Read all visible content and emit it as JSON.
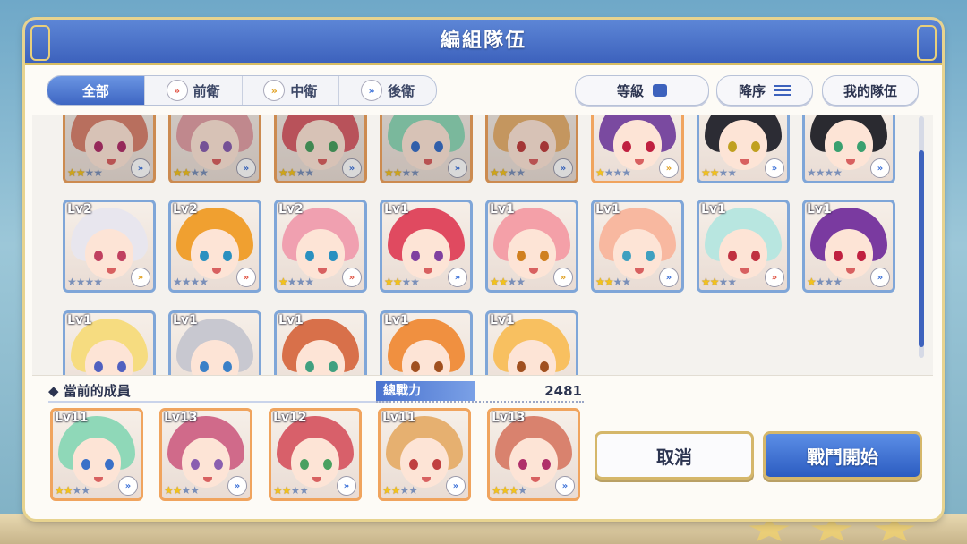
{
  "window": {
    "title": "編組隊伍"
  },
  "filters": {
    "tabs": [
      {
        "label": "全部",
        "icon": ""
      },
      {
        "label": "前衛",
        "icon": "front-position-icon"
      },
      {
        "label": "中衛",
        "icon": "middle-position-icon"
      },
      {
        "label": "後衛",
        "icon": "rear-position-icon"
      }
    ],
    "active": "全部"
  },
  "sort": {
    "level_label": "等級",
    "order_label": "降序",
    "my_team_label": "我的隊伍"
  },
  "roster": {
    "row1": [
      {
        "level": "",
        "stars": 2,
        "position": "back",
        "selected": true,
        "frame": "orange",
        "hair": "#d9826e",
        "eye": "#b0306a"
      },
      {
        "level": "",
        "stars": 2,
        "position": "back",
        "selected": true,
        "frame": "orange",
        "hair": "#e2a0a6",
        "eye": "#8a5fb0"
      },
      {
        "level": "",
        "stars": 2,
        "position": "back",
        "selected": true,
        "frame": "orange",
        "hair": "#d8606a",
        "eye": "#4aa060"
      },
      {
        "level": "",
        "stars": 2,
        "position": "back",
        "selected": true,
        "frame": "orange",
        "hair": "#8fd8b8",
        "eye": "#3a70c8"
      },
      {
        "level": "",
        "stars": 2,
        "position": "back",
        "selected": true,
        "frame": "orange",
        "hair": "#e6b070",
        "eye": "#c04040"
      },
      {
        "level": "",
        "stars": 1,
        "position": "mid",
        "selected": false,
        "frame": "orange",
        "hair": "#7a4aa0",
        "eye": "#c02040"
      },
      {
        "level": "",
        "stars": 2,
        "position": "back",
        "selected": false,
        "frame": "blue",
        "hair": "#2c2c34",
        "eye": "#c0a020"
      },
      {
        "level": "",
        "stars": 0,
        "position": "back",
        "selected": false,
        "frame": "blue",
        "hair": "#2a2a30",
        "eye": "#3aa070"
      }
    ],
    "row2": [
      {
        "level": "Lv2",
        "stars": 0,
        "position": "mid",
        "frame": "blue",
        "hair": "#e8e6ee",
        "eye": "#c04060"
      },
      {
        "level": "Lv2",
        "stars": 0,
        "position": "front",
        "frame": "blue",
        "hair": "#f0a030",
        "eye": "#2a90c0"
      },
      {
        "level": "Lv2",
        "stars": 1,
        "position": "front",
        "frame": "blue",
        "hair": "#f0a0b0",
        "eye": "#2a90c0"
      },
      {
        "level": "Lv1",
        "stars": 2,
        "position": "back",
        "frame": "blue",
        "hair": "#e04a60",
        "eye": "#8040a0"
      },
      {
        "level": "Lv1",
        "stars": 2,
        "position": "mid",
        "frame": "blue",
        "hair": "#f4a0a8",
        "eye": "#d08020"
      },
      {
        "level": "Lv1",
        "stars": 2,
        "position": "back",
        "frame": "blue",
        "hair": "#f8b8a0",
        "eye": "#40a0c0"
      },
      {
        "level": "Lv1",
        "stars": 2,
        "position": "front",
        "frame": "blue",
        "hair": "#b8e6e0",
        "eye": "#c03040"
      },
      {
        "level": "Lv1",
        "stars": 1,
        "position": "back",
        "frame": "blue",
        "hair": "#7a3aa0",
        "eye": "#c02040"
      }
    ],
    "row3": [
      {
        "level": "Lv1",
        "stars": 0,
        "position": "back",
        "frame": "blue",
        "hair": "#f6dc80",
        "eye": "#5060c0"
      },
      {
        "level": "Lv1",
        "stars": 0,
        "position": "back",
        "frame": "blue",
        "hair": "#c8c8d0",
        "eye": "#3a80c8"
      },
      {
        "level": "Lv1",
        "stars": 0,
        "position": "back",
        "frame": "blue",
        "hair": "#d8704a",
        "eye": "#40a080"
      },
      {
        "level": "Lv1",
        "stars": 0,
        "position": "back",
        "frame": "blue",
        "hair": "#f09040",
        "eye": "#a05020"
      },
      {
        "level": "Lv1",
        "stars": 0,
        "position": "back",
        "frame": "blue",
        "hair": "#f8c060",
        "eye": "#a05020"
      }
    ]
  },
  "team": {
    "label": "當前的成員",
    "power_label": "總戰力",
    "power_value": "2481",
    "members": [
      {
        "level": "Lv11",
        "stars": 2,
        "position": "back",
        "hair": "#8fd8b8",
        "eye": "#3a70c8"
      },
      {
        "level": "Lv13",
        "stars": 2,
        "position": "back",
        "hair": "#d06a8a",
        "eye": "#8a5fb0"
      },
      {
        "level": "Lv12",
        "stars": 2,
        "position": "back",
        "hair": "#d8606a",
        "eye": "#4aa060"
      },
      {
        "level": "Lv11",
        "stars": 2,
        "position": "back",
        "hair": "#e6b070",
        "eye": "#c04040"
      },
      {
        "level": "Lv13",
        "stars": 3,
        "position": "back",
        "hair": "#d9826e",
        "eye": "#b0306a"
      }
    ]
  },
  "actions": {
    "cancel_label": "取消",
    "start_label": "戰鬥開始"
  },
  "colors": {
    "title_blue": "#3d62bd",
    "accent_gold": "#d5b76a",
    "star_gold": "#f2c21c"
  }
}
